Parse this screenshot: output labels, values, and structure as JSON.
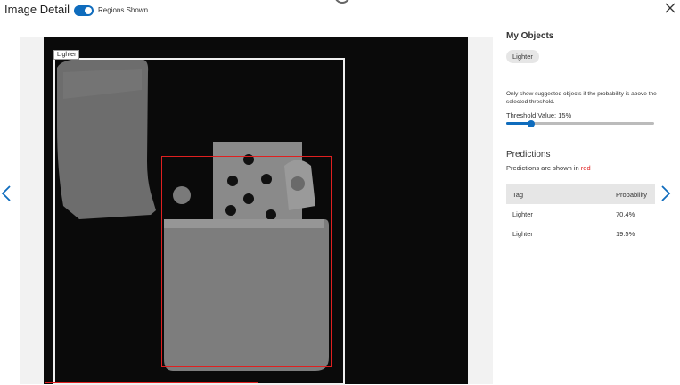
{
  "header": {
    "title": "Image Detail",
    "toggle_label": "Regions Shown",
    "toggle_on": true
  },
  "image": {
    "box_label": "Lighter"
  },
  "panel": {
    "my_objects_heading": "My Objects",
    "my_objects": [
      "Lighter"
    ],
    "threshold_note": "Only show suggested objects if the probability is above the selected threshold.",
    "threshold_label": "Threshold Value: 15%",
    "threshold_value": 15,
    "predictions_heading": "Predictions",
    "predictions_note_prefix": "Predictions are shown in ",
    "predictions_note_color": "red",
    "table": {
      "headers": [
        "Tag",
        "Probability"
      ],
      "rows": [
        {
          "tag": "Lighter",
          "probability": "70.4%"
        },
        {
          "tag": "Lighter",
          "probability": "19.5%"
        }
      ]
    }
  },
  "colors": {
    "accent": "#0f6cbd",
    "prediction": "#e02020"
  },
  "icons": {
    "close": "close-icon",
    "prev": "chevron-left-icon",
    "next": "chevron-right-icon"
  }
}
